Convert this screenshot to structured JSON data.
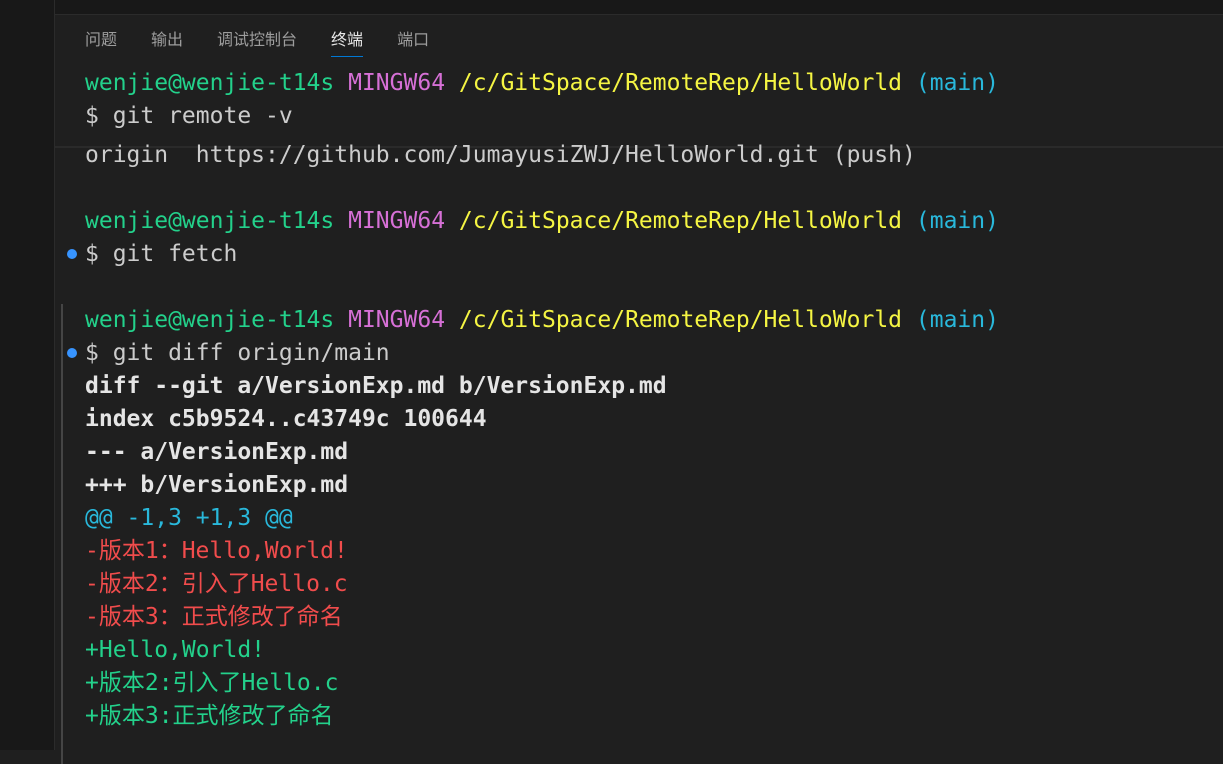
{
  "tabs": [
    {
      "label": "问题",
      "active": false
    },
    {
      "label": "输出",
      "active": false
    },
    {
      "label": "调试控制台",
      "active": false
    },
    {
      "label": "终端",
      "active": true
    },
    {
      "label": "端口",
      "active": false
    }
  ],
  "terminal": {
    "prompt1": {
      "user": "wenjie@wenjie-t14s",
      "sys": "MINGW64",
      "path": "/c/GitSpace/RemoteRep/HelloWorld",
      "branch": "(main)"
    },
    "cmd1": "$ git remote -v",
    "output1": "origin  https://github.com/JumayusiZWJ/HelloWorld.git (push)",
    "prompt2": {
      "user": "wenjie@wenjie-t14s",
      "sys": "MINGW64",
      "path": "/c/GitSpace/RemoteRep/HelloWorld",
      "branch": "(main)"
    },
    "cmd2": "$ git fetch",
    "prompt3": {
      "user": "wenjie@wenjie-t14s",
      "sys": "MINGW64",
      "path": "/c/GitSpace/RemoteRep/HelloWorld",
      "branch": "(main)"
    },
    "cmd3": "$ git diff origin/main",
    "diff_header": [
      "diff --git a/VersionExp.md b/VersionExp.md",
      "index c5b9524..c43749c 100644",
      "--- a/VersionExp.md",
      "+++ b/VersionExp.md"
    ],
    "hunk": "@@ -1,3 +1,3 @@",
    "removed": [
      "-版本1：Hello,World!",
      "-版本2：引入了Hello.c",
      "-版本3：正式修改了命名"
    ],
    "added": [
      "+Hello,World!",
      "+版本2:引入了Hello.c",
      "+版本3:正式修改了命名"
    ]
  },
  "colors": {
    "user": "#23d18b",
    "system": "#d670d6",
    "path": "#f5f543",
    "branch": "#29b8db",
    "removed": "#f14c4c",
    "added": "#23d18b",
    "decoration": "#3794ff"
  }
}
